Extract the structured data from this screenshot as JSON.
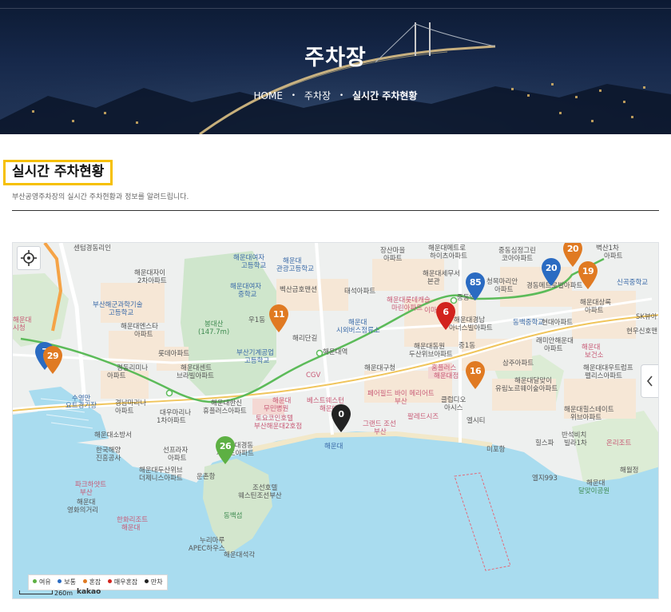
{
  "page": {
    "title": "주차장",
    "breadcrumb": {
      "home": "HOME",
      "level1": "주차장",
      "current": "실시간 주차현황"
    }
  },
  "section": {
    "heading": "실시간 주차현황",
    "description": "부산공영주차장의 실시간 주차현황과 정보를 알려드립니다."
  },
  "map": {
    "colors": {
      "available": "#5db043",
      "normal": "#2a6bc2",
      "congested": "#e07a22",
      "very_congested": "#d2231d",
      "full": "#222222",
      "sea": "#a9dcef",
      "park": "#cfe6cf",
      "road_major": "#ffffff",
      "subway": "#5cbb59"
    },
    "legend": [
      {
        "label": "여유",
        "color": "#5db043"
      },
      {
        "label": "보통",
        "color": "#2a6bc2"
      },
      {
        "label": "혼잡",
        "color": "#e07a22"
      },
      {
        "label": "매우혼잡",
        "color": "#d2231d"
      },
      {
        "label": "만차",
        "color": "#222222"
      }
    ],
    "markers": [
      {
        "label": "7",
        "color": "#2a6bc2"
      },
      {
        "label": "29",
        "color": "#e07a22"
      },
      {
        "label": "11",
        "color": "#e07a22"
      },
      {
        "label": "0",
        "color": "#222222"
      },
      {
        "label": "26",
        "color": "#5db043"
      },
      {
        "label": "6",
        "color": "#d2231d"
      },
      {
        "label": "85",
        "color": "#2a6bc2"
      },
      {
        "label": "16",
        "color": "#e07a22"
      },
      {
        "label": "20",
        "color": "#e07a22"
      },
      {
        "label": "20",
        "color": "#2a6bc2"
      },
      {
        "label": "19",
        "color": "#e07a22"
      }
    ],
    "labels": [
      "센텀경동리인",
      "해운대자이",
      "2차아파트",
      "부산해군과학기술",
      "고등학교",
      "해운대엔스타",
      "아파트",
      "롯데아파트",
      "경동리미나",
      "아파트",
      "해운대센트",
      "브라빌아파트",
      "수영만",
      "요트경기장",
      "경남마리나",
      "아파트",
      "대우마리나",
      "1차아파트",
      "해운대소방서",
      "한국해양",
      "진흥공사",
      "선프라자",
      "아파트",
      "해운대두산위브",
      "더제니스아파트",
      "운촌항",
      "파크하얏트",
      "부산",
      "해운대",
      "영화의거리",
      "해운대여자",
      "고등학교",
      "해운대",
      "관광고등학교",
      "해운대여자",
      "중학교",
      "벡산금호맨션",
      "봉대산",
      "(147.7m)",
      "우1동",
      "해리단길",
      "부산기계공업",
      "고등학교",
      "해운대역",
      "해운대",
      "무민병원",
      "CGV",
      "해운대한신",
      "휴플러스아파트",
      "해운대경동",
      "제이드아파트",
      "토요코인호텔",
      "부산해운대2호점",
      "베스트웨스턴",
      "해운대",
      "해운대",
      "장산마을",
      "아파트",
      "태석아파트",
      "해운대",
      "시외버스정류소",
      "해운대구청",
      "페어필드 바이 메리어트",
      "부산",
      "그랜드 조선",
      "부산",
      "해운대롯데캐슬",
      "마린아파트",
      "해운대세무서",
      "본관",
      "이마트",
      "해운대경남",
      "아너스빌아파트",
      "해운대동원",
      "두산위브아파트",
      "홈플러스",
      "해운대점",
      "클럽디오",
      "아시스",
      "팔레드시즈",
      "중1동",
      "중동역",
      "해운대메트로",
      "하이츠아파트",
      "중동심정그린",
      "코아아파트",
      "청목마리안",
      "아파트",
      "경동메트로빌아파트",
      "동백중학교",
      "래미안해운대",
      "아파트",
      "삼주아파트",
      "해운대달맞이",
      "유림노르웨이숲아파트",
      "엘시티",
      "힐스파",
      "미포항",
      "반석비치",
      "빌라1차",
      "해운대힐스테이트",
      "위브아파트",
      "해운대",
      "보건소",
      "해운대대우트럼프",
      "펠리스아파트",
      "현대아파트",
      "해운대상록",
      "아파트",
      "벽산1차",
      "아파트",
      "신곡중학교",
      "SK뷰아",
      "현우신호맨",
      "온리조트",
      "해월정",
      "해운대",
      "달맞이공원",
      "엘지993",
      "조선호텔",
      "웨스틴조선부산",
      "동백섬",
      "누리마루",
      "APEC하우스",
      "해운대석각",
      "한화리조트",
      "해운대",
      "해운대",
      "시청"
    ],
    "scale": "260m",
    "attribution": "kakao"
  }
}
